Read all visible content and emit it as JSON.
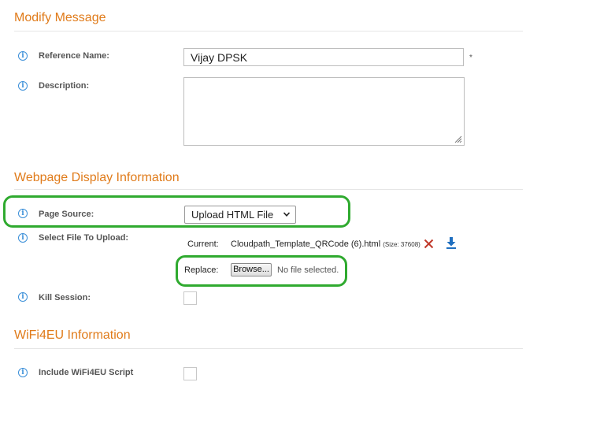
{
  "sections": {
    "modify": "Modify Message",
    "display": "Webpage Display Information",
    "wifi": "WiFi4EU Information"
  },
  "fields": {
    "reference_name_label": "Reference Name:",
    "reference_name_value": "Vijay DPSK",
    "required_mark": "*",
    "description_label": "Description:",
    "page_source_label": "Page Source:",
    "page_source_value": "Upload HTML File",
    "select_file_label": "Select File To Upload:",
    "current_label": "Current:",
    "current_file": "Cloudpath_Template_QRCode (6).html",
    "current_size": "(Size: 37608)",
    "replace_label": "Replace:",
    "browse_label": "Browse...",
    "no_file_text": "No file selected.",
    "kill_session_label": "Kill Session:",
    "include_wifi_label": "Include WiFi4EU Script"
  },
  "icons": {
    "info": "i"
  },
  "colors": {
    "section_title": "#e07b1a",
    "info_icon": "#3a8fd8",
    "highlight": "#2faa2f",
    "delete_icon": "#c0392b",
    "download_icon": "#1f6fc0"
  }
}
